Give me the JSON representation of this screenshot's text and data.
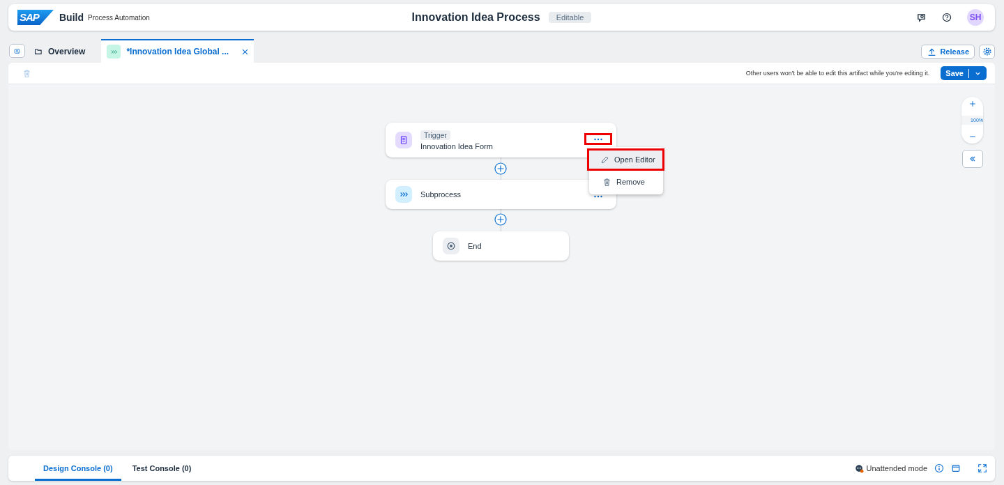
{
  "app": {
    "logo": "SAP",
    "product": "Build",
    "module": "Process Automation"
  },
  "header": {
    "title": "Innovation Idea Process",
    "badge": "Editable",
    "avatar": "SH"
  },
  "tabs": [
    {
      "label": "Overview",
      "kind": "overview",
      "selected": false,
      "closable": false
    },
    {
      "label": "*Innovation Idea Global ...",
      "kind": "subprocess",
      "selected": true,
      "closable": true
    }
  ],
  "actions": {
    "release": "Release"
  },
  "toolbar": {
    "notice": "Other users won't be able to edit this artifact while you're editing it.",
    "save": "Save"
  },
  "canvas": {
    "zoom": "100%",
    "nodes": [
      {
        "kind": "trigger",
        "tag": "Trigger",
        "label": "Innovation Idea Form",
        "highlighted": true
      },
      {
        "kind": "subprocess",
        "label": "Subprocess",
        "highlighted": false
      },
      {
        "kind": "end",
        "label": "End"
      }
    ],
    "menu": [
      {
        "label": "Open Editor",
        "kind": "edit",
        "highlighted": true
      },
      {
        "label": "Remove",
        "kind": "remove",
        "highlighted": false
      }
    ]
  },
  "console": {
    "tabs": [
      {
        "label": "Design Console (0)",
        "selected": true
      },
      {
        "label": "Test Console (0)",
        "selected": false
      }
    ],
    "mode": "Unattended mode"
  }
}
